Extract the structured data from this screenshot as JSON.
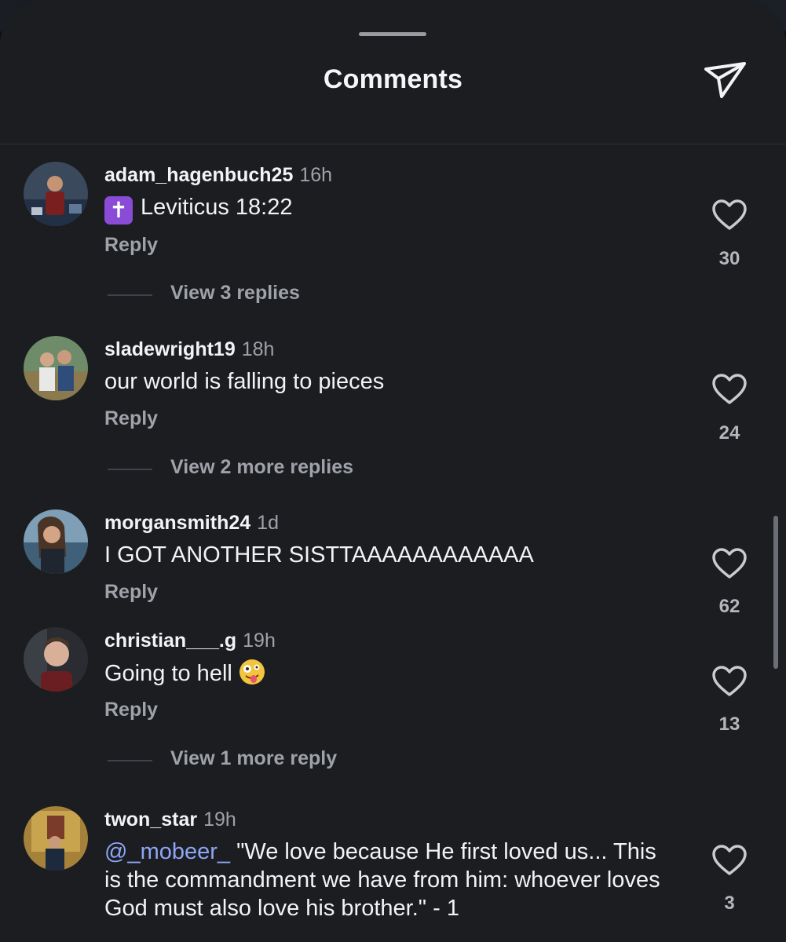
{
  "header": {
    "title": "Comments",
    "send_icon": "paper-plane-icon"
  },
  "colors": {
    "background": "#1b1d21",
    "mention": "#8ea5f5",
    "muted": "#9fa2a8",
    "badge": "#8a4bd6"
  },
  "comments": [
    {
      "username": "adam_hagenbuch25",
      "time": "16h",
      "badge": "✝",
      "text": "Leviticus 18:22",
      "reply": "Reply",
      "likes": "30",
      "view_replies": "View 3 replies"
    },
    {
      "username": "sladewright19",
      "time": "18h",
      "text": "our world is falling to pieces",
      "reply": "Reply",
      "likes": "24",
      "view_replies": "View 2 more replies"
    },
    {
      "username": "morgansmith24",
      "time": "1d",
      "text": "I GOT ANOTHER SISTTAAAAAAAAAAAA",
      "reply": "Reply",
      "likes": "62"
    },
    {
      "username": "christian___.g",
      "time": "19h",
      "text": "Going to hell",
      "emoji": "zany-face",
      "reply": "Reply",
      "likes": "13",
      "view_replies": "View 1 more reply"
    },
    {
      "username": "twon_star",
      "time": "19h",
      "mention": "@_mobeer_",
      "text": "\"We love because He first loved us... This is the commandment we have from him: whoever loves God must also love his brother.\" - 1",
      "likes": "3"
    }
  ]
}
